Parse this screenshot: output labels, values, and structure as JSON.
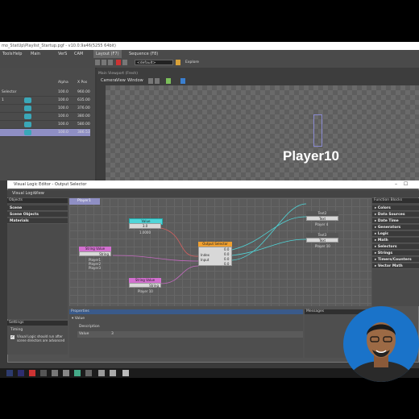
{
  "app": {
    "title": "mo_StatUp\\Playlist_Startup.pgf - v10.0.9a46(5255 64bit)",
    "menus": [
      "Tools",
      "Help"
    ],
    "toolbar_tabs": [
      "Main",
      "VerS",
      "CAM"
    ],
    "layout_tab": "Layout (F7)",
    "sequence_tab": "Sequence (F8)",
    "default_combo": "<default>",
    "explore_button": "Explore"
  },
  "layers": {
    "headers": [
      "Alpha",
      "X Pos"
    ],
    "rows": [
      {
        "name": "Selector",
        "alpha": "100.0",
        "xpos": "960.00"
      },
      {
        "name": "1",
        "alpha": "100.0",
        "xpos": "635.00"
      },
      {
        "name": "",
        "alpha": "100.0",
        "xpos": "376.00"
      },
      {
        "name": "",
        "alpha": "100.0",
        "xpos": "380.00"
      },
      {
        "name": "",
        "alpha": "100.0",
        "xpos": "580.00"
      },
      {
        "name": "",
        "alpha": "100.0",
        "xpos": "386.53"
      }
    ]
  },
  "preview": {
    "title": "Main Viewport (Fresh)",
    "menus": [
      "Camera",
      "View",
      "Window"
    ],
    "player_text": "Player10"
  },
  "vle": {
    "title": "Visual Logic Editor - Output Selector",
    "tabs": [
      "Visual Logic",
      "View"
    ],
    "objects_header": "Objects",
    "object_categories": [
      "Scene",
      "Scene Objects",
      "Materials"
    ],
    "graph_tab": "Player1",
    "function_header": "Function Blocks",
    "function_categories": [
      "Colors",
      "Data Sources",
      "Date Time",
      "Generators",
      "Logic",
      "Math",
      "Selectors",
      "Strings",
      "Timers/Counters",
      "Vector Math"
    ],
    "nodes": {
      "value": {
        "title": "Value",
        "value": "3.0",
        "caption": "1.0000"
      },
      "string1": {
        "title": "String Value",
        "port": "String",
        "items": [
          "Player1",
          "Player2",
          "Player3"
        ]
      },
      "string2": {
        "title": "String Value",
        "port": "String",
        "caption": "Player 10"
      },
      "output": {
        "title": "Output Selector",
        "ports": [
          "Index",
          "Input"
        ],
        "outs": [
          "0.0",
          "0.0",
          "0.0",
          "0.0"
        ]
      },
      "text2": {
        "title": "Text2",
        "port": "Text",
        "caption": "Player 4"
      },
      "text3": {
        "title": "Text3",
        "port": "Text",
        "caption": "Player 10"
      }
    },
    "properties_header": "Properties",
    "properties_section": "Value",
    "description_label": "Description",
    "value_label": "Value",
    "value_field": "3",
    "messages_header": "Messages",
    "settings_header": "Settings",
    "timing_label": "Timing",
    "settings_checkbox": "Visual Logic should run after scene directors are advanced"
  },
  "colors": {
    "accent": "#3aa7b8",
    "node_cyan": "#4fd5d8",
    "node_pink": "#d36fd0",
    "node_orange": "#f0a030",
    "webcam_bg": "#1a73c9"
  }
}
